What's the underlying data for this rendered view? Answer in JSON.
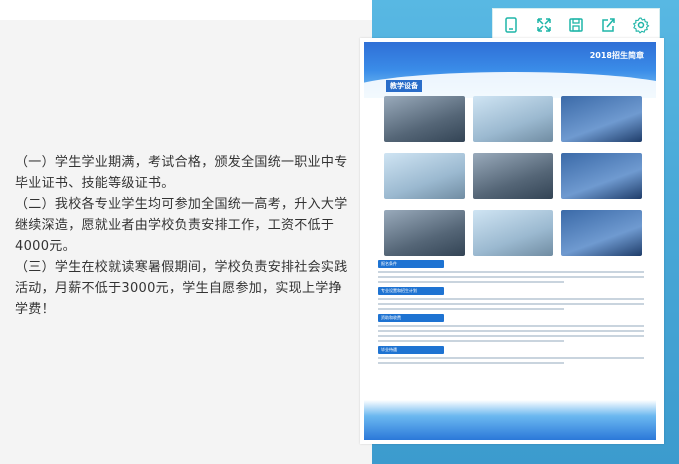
{
  "article": {
    "paragraphs": [
      "（一）学生学业期满，考试合格，颁发全国统一职业中专毕业证书、技能等级证书。",
      "（二）我校各专业学生均可参加全国统一高考，升入大学继续深造，愿就业者由学校负责安排工作，工资不低于4000元。",
      "（三）学生在校就读寒暑假期间，学校负责安排社会实践活动，月薪不低于3000元，学生自愿参加，实现上学挣学费！"
    ]
  },
  "toolbar": {
    "buttons": [
      {
        "name": "phone-preview",
        "icon": "phone-icon"
      },
      {
        "name": "fullscreen",
        "icon": "expand-icon"
      },
      {
        "name": "save",
        "icon": "save-icon"
      },
      {
        "name": "share",
        "icon": "share-icon"
      },
      {
        "name": "settings",
        "icon": "gear-icon"
      }
    ]
  },
  "poster": {
    "title": "2018招生简章",
    "section": "教学设备",
    "bars": [
      "报名条件",
      "专业设置和招生计划",
      "资助和收费",
      "毕业待遇"
    ]
  },
  "colors": {
    "accent": "#1fb5a8",
    "panel_bg": "#f4f4f4",
    "right_bg": "#4aa9d8",
    "poster_blue": "#1e73d2"
  }
}
